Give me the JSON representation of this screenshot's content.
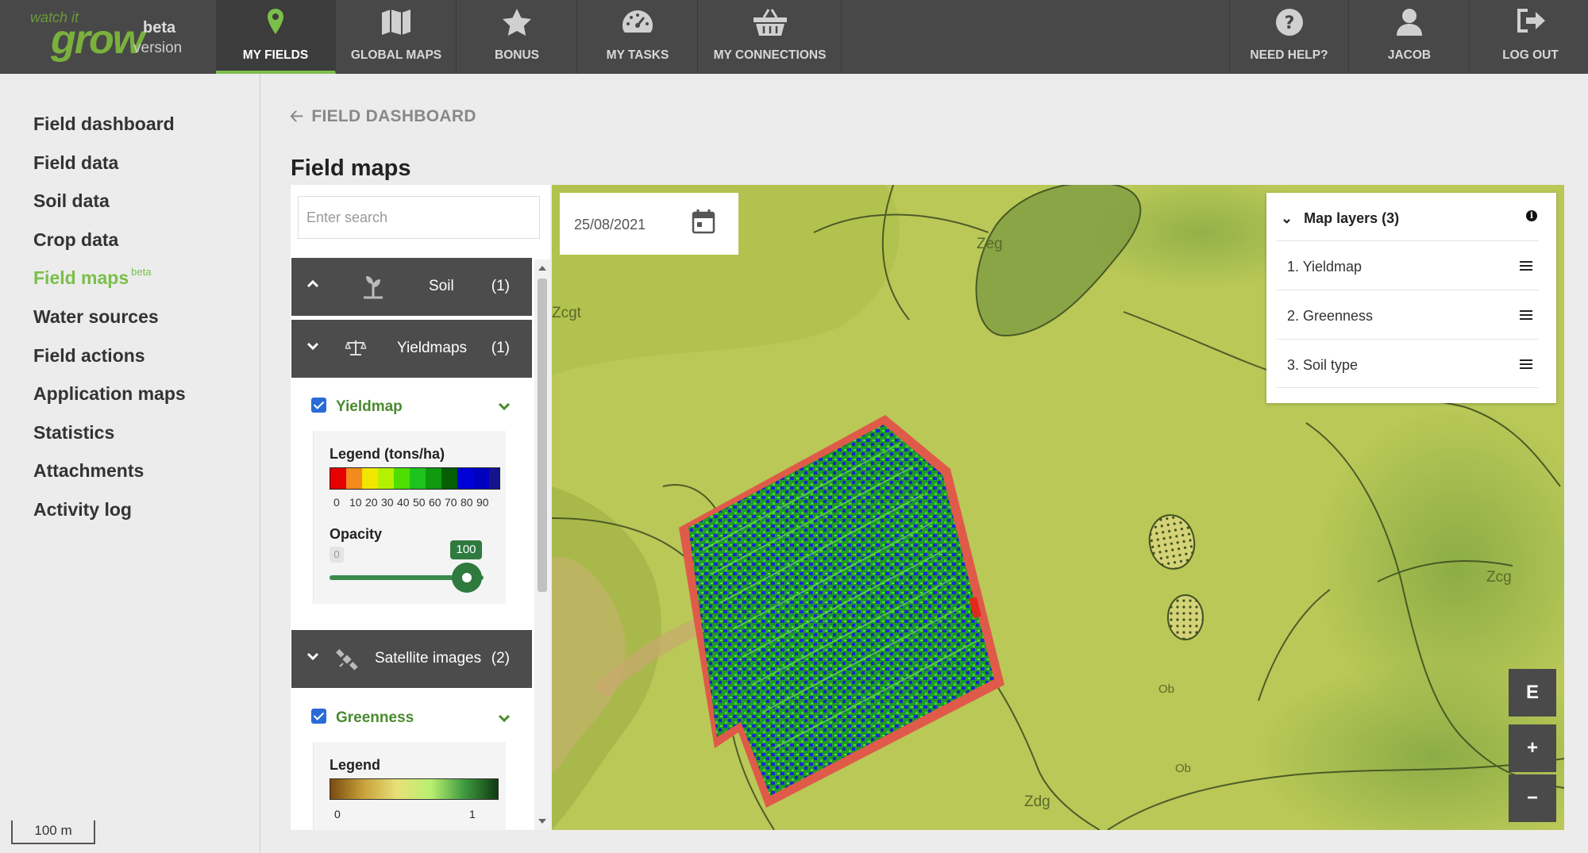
{
  "app": {
    "logo_top": "watch it",
    "logo_main": "grow",
    "beta": "beta",
    "version": "version"
  },
  "nav": [
    {
      "label": "MY FIELDS",
      "icon": "map-pin-icon"
    },
    {
      "label": "GLOBAL MAPS",
      "icon": "map-icon"
    },
    {
      "label": "BONUS",
      "icon": "star-icon"
    },
    {
      "label": "MY TASKS",
      "icon": "dashboard-icon"
    },
    {
      "label": "MY CONNECTIONS",
      "icon": "basket-icon"
    }
  ],
  "nav_right": [
    {
      "label": "NEED HELP?",
      "icon": "question-icon"
    },
    {
      "label": "JACOB",
      "icon": "user-icon"
    },
    {
      "label": "LOG OUT",
      "icon": "logout-icon"
    }
  ],
  "sidebar": {
    "items": [
      "Field dashboard",
      "Field data",
      "Soil data",
      "Crop data",
      "Field maps",
      "Water sources",
      "Field actions",
      "Application maps",
      "Statistics",
      "Attachments",
      "Activity log"
    ],
    "active_index": 4,
    "beta_tag": "beta"
  },
  "scale_label": "100 m",
  "breadcrumb": "FIELD DASHBOARD",
  "page_title": "Field maps",
  "search": {
    "placeholder": "Enter search"
  },
  "groups": {
    "soil": {
      "name": "Soil",
      "count": "(1)"
    },
    "yieldmaps": {
      "name": "Yieldmaps",
      "count": "(1)"
    },
    "satellite": {
      "name": "Satellite images",
      "count": "(2)"
    }
  },
  "yieldmap_layer": {
    "name": "Yieldmap",
    "checked": true,
    "legend_title": "Legend (tons/ha)",
    "legend_colors": [
      "#e60000",
      "#f28a1e",
      "#f2e600",
      "#b5f000",
      "#4ede00",
      "#1ec41e",
      "#0f9a0f",
      "#045e04",
      "#0000d8",
      "#0000bf",
      "#14148c"
    ],
    "legend_ticks": [
      "0",
      "10",
      "20",
      "30",
      "40",
      "50",
      "60",
      "70",
      "80",
      "90"
    ],
    "opacity_label": "Opacity",
    "opacity_min": "0",
    "opacity_value": "100"
  },
  "greenness_layer": {
    "name": "Greenness",
    "checked": true,
    "legend_title": "Legend",
    "legend_min": "0",
    "legend_max": "1"
  },
  "date": "25/08/2021",
  "map_layers": {
    "title": "Map layers (3)",
    "items": [
      "1. Yieldmap",
      "2. Greenness",
      "3. Soil type"
    ]
  },
  "map_labels": [
    "Zeg",
    "Zcgt",
    "Zcg",
    "Zdg",
    "Ob",
    "Ob"
  ],
  "map_controls": {
    "e": "E",
    "zoom_in": "+",
    "zoom_out": "−"
  }
}
